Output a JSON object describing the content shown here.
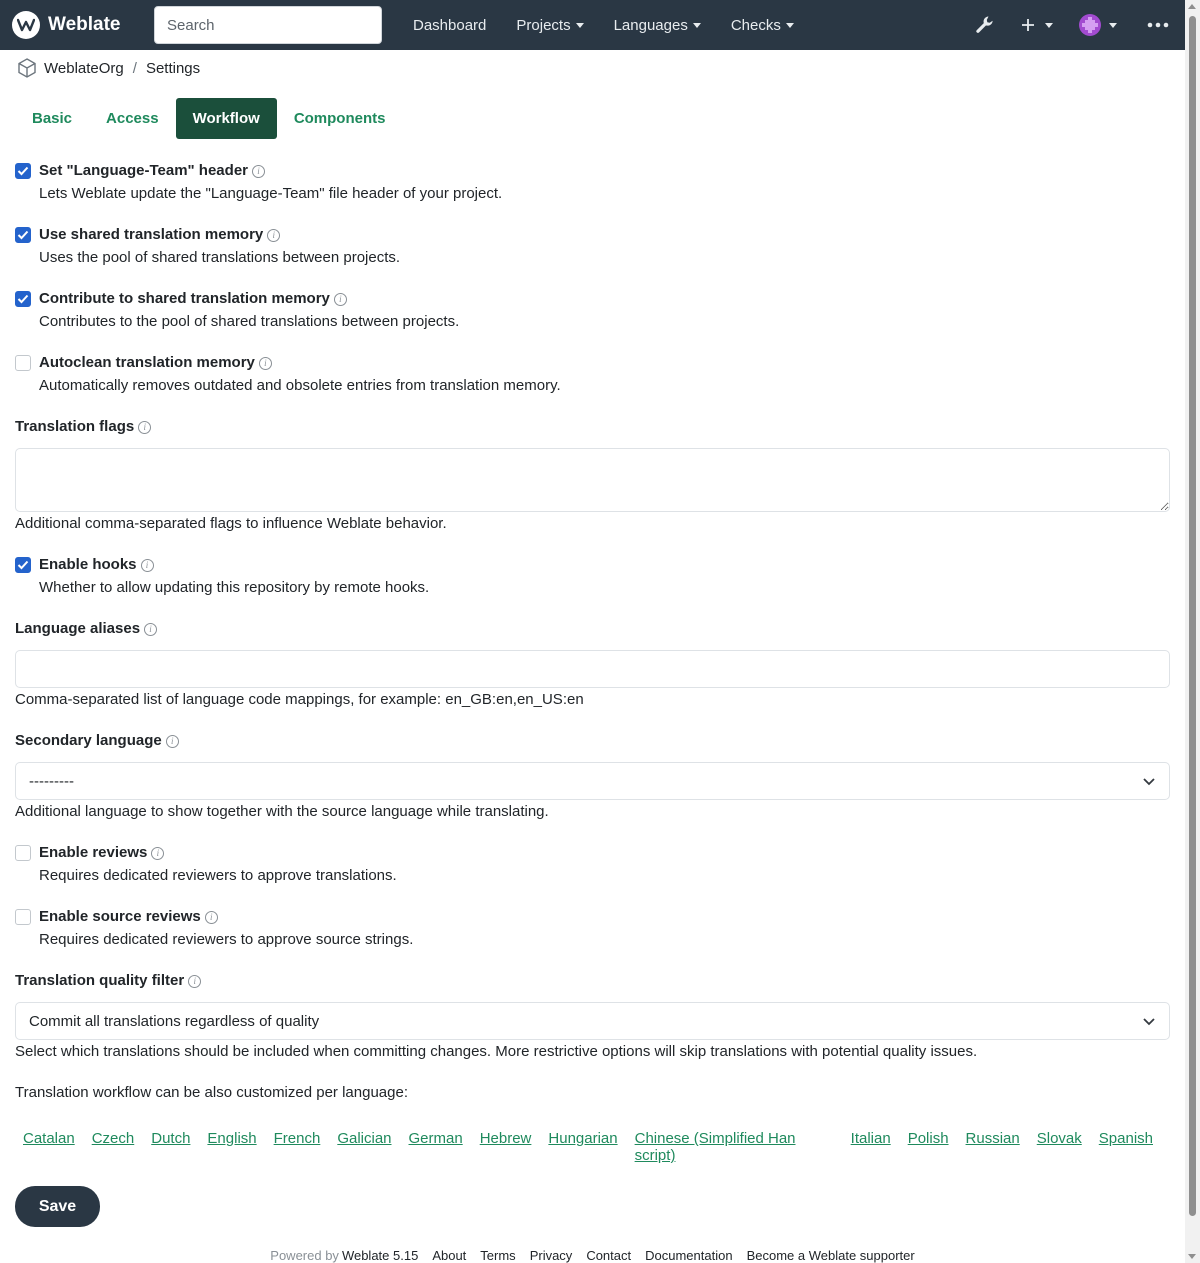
{
  "navbar": {
    "brand": "Weblate",
    "search_placeholder": "Search",
    "links": [
      "Dashboard",
      "Projects",
      "Languages",
      "Checks"
    ],
    "icons": [
      "wrench-icon",
      "plus-icon",
      "avatar",
      "more-icon"
    ]
  },
  "breadcrumb": {
    "project": "WeblateOrg",
    "separator": "/",
    "page": "Settings"
  },
  "tabs": [
    {
      "label": "Basic",
      "active": false
    },
    {
      "label": "Access",
      "active": false
    },
    {
      "label": "Workflow",
      "active": true
    },
    {
      "label": "Components",
      "active": false
    }
  ],
  "checks": [
    {
      "label": "Set \"Language-Team\" header",
      "help": "Lets Weblate update the \"Language-Team\" file header of your project.",
      "checked": true
    },
    {
      "label": "Use shared translation memory",
      "help": "Uses the pool of shared translations between projects.",
      "checked": true
    },
    {
      "label": "Contribute to shared translation memory",
      "help": "Contributes to the pool of shared translations between projects.",
      "checked": true
    },
    {
      "label": "Autoclean translation memory",
      "help": "Automatically removes outdated and obsolete entries from translation memory.",
      "checked": false
    }
  ],
  "translation_flags": {
    "label": "Translation flags",
    "value": "",
    "help": "Additional comma-separated flags to influence Weblate behavior."
  },
  "enable_hooks": {
    "label": "Enable hooks",
    "help": "Whether to allow updating this repository by remote hooks.",
    "checked": true
  },
  "language_aliases": {
    "label": "Language aliases",
    "value": "",
    "help": "Comma-separated list of language code mappings, for example: en_GB:en,en_US:en"
  },
  "secondary_language": {
    "label": "Secondary language",
    "value": "---------",
    "help": "Additional language to show together with the source language while translating."
  },
  "enable_reviews": {
    "label": "Enable reviews",
    "help": "Requires dedicated reviewers to approve translations.",
    "checked": false
  },
  "enable_source_reviews": {
    "label": "Enable source reviews",
    "help": "Requires dedicated reviewers to approve source strings.",
    "checked": false
  },
  "quality_filter": {
    "label": "Translation quality filter",
    "value": "Commit all translations regardless of quality",
    "help": "Select which translations should be included when committing changes. More restrictive options will skip translations with potential quality issues."
  },
  "per_language_note": "Translation workflow can be also customized per language:",
  "languages": [
    "Catalan",
    "Czech",
    "Dutch",
    "English",
    "French",
    "Galician",
    "German",
    "Hebrew",
    "Hungarian",
    "Chinese (Simplified Han script)",
    "Italian",
    "Polish",
    "Russian",
    "Slovak",
    "Spanish"
  ],
  "save_label": "Save",
  "footer": {
    "powered_by": "Powered by",
    "version": "Weblate 5.15",
    "links": [
      "About",
      "Terms",
      "Privacy",
      "Contact",
      "Documentation",
      "Become a Weblate supporter"
    ]
  },
  "colors": {
    "navbar": "#2a3744",
    "accent": "#1f8a5d",
    "active_tab": "#1b4f3b",
    "checkbox": "#2463cc"
  }
}
